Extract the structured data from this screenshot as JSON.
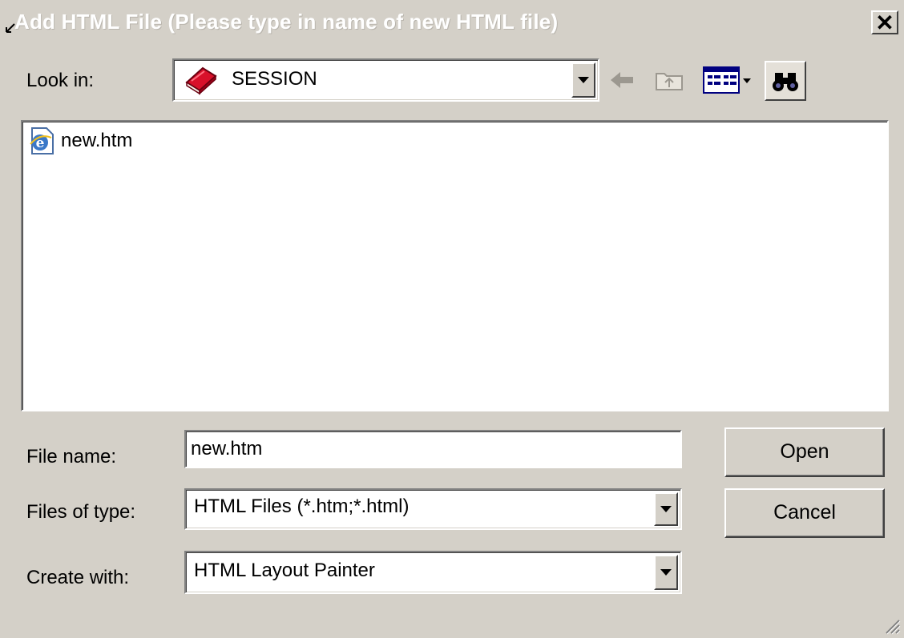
{
  "window": {
    "title": "Add HTML File (Please type in name of new HTML file)",
    "close_glyph": "✕"
  },
  "look_in": {
    "label": "Look in:",
    "value": "SESSION",
    "icon": "book-icon"
  },
  "toolbar": {
    "back_icon": "back-arrow-icon",
    "up_icon": "up-folder-icon",
    "view_icon": "view-menu-icon",
    "find_icon": "binoculars-icon"
  },
  "file_list": {
    "items": [
      {
        "name": "new.htm",
        "icon": "ie-document-icon"
      }
    ]
  },
  "form": {
    "file_name_label": "File name:",
    "file_name_value": "new.htm",
    "files_of_type_label": "Files of type:",
    "files_of_type_value": "HTML Files (*.htm;*.html)",
    "create_with_label": "Create with:",
    "create_with_value": "HTML Layout Painter"
  },
  "buttons": {
    "open": "Open",
    "cancel": "Cancel"
  },
  "colors": {
    "face": "#d4d0c8",
    "highlight": "#ffffff",
    "shadow": "#808080"
  }
}
